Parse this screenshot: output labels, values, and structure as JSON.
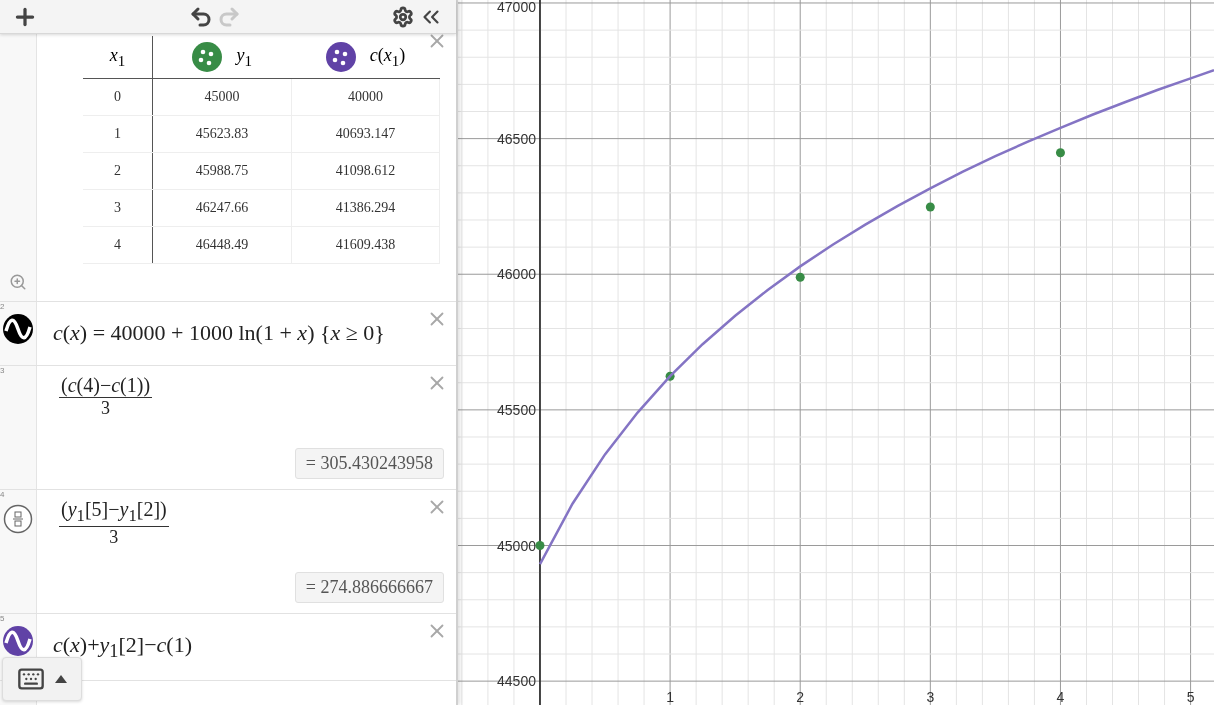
{
  "toolbar": {
    "undo": {
      "disabled": false
    },
    "redo": {
      "disabled": true
    }
  },
  "expressions": [
    {
      "kind": "table",
      "columns": [
        {
          "header": "*x*$_{1}$"
        },
        {
          "header": "*y*$_{1}$",
          "color": "#388c46"
        },
        {
          "header": "*c*(*x*$_{1}$)",
          "color": "#6042a6"
        }
      ],
      "rows": [
        [
          "0",
          "45000",
          "40000"
        ],
        [
          "1",
          "45623.83",
          "40693.147"
        ],
        [
          "2",
          "45988.75",
          "41098.612"
        ],
        [
          "3",
          "46247.66",
          "41386.294"
        ],
        [
          "4",
          "46448.49",
          "41609.438"
        ]
      ]
    },
    {
      "kind": "function",
      "number": "2",
      "color": "#000000",
      "latex": "*c*(*x*) = 40000 + 1000 ln(1 + *x*) {*x* ≥ 0}"
    },
    {
      "kind": "fraction",
      "number": "3",
      "numerator": "(*c*(4)−*c*(1))",
      "denominator": "3",
      "result": "= 305.430243958"
    },
    {
      "kind": "fraction",
      "number": "4",
      "numerator": "(*y*$_{1}$[5]−*y*$_{1}$[2])",
      "denominator": "3",
      "result": "= 274.886666667"
    },
    {
      "kind": "function",
      "number": "5",
      "color": "#6042a6",
      "latex": "*c*(*x*)+*y*$_{1}$[2]−*c*(1)"
    }
  ],
  "graph": {
    "chart_data": {
      "type": "line",
      "grid": true,
      "x": [
        0,
        0.25,
        0.5,
        0.75,
        1,
        1.25,
        1.5,
        1.75,
        2,
        2.25,
        2.5,
        2.75,
        3,
        3.25,
        3.5,
        3.75,
        4,
        4.25,
        4.5,
        4.75,
        5,
        5.18
      ],
      "series": [
        {
          "type": "scatter",
          "color": "#388c46",
          "values": [
            45000,
            null,
            null,
            null,
            45624,
            null,
            null,
            null,
            45989,
            null,
            null,
            null,
            46248,
            null,
            null,
            null,
            46448,
            null,
            null,
            null,
            null,
            null
          ]
        },
        {
          "color": "#8474c4",
          "values": [
            44931,
            45154,
            45336,
            45490,
            45624,
            45742,
            45847,
            45942,
            46029,
            46109,
            46183,
            46252,
            46317,
            46378,
            46435,
            46489,
            46540,
            46589,
            46635,
            46680,
            46722,
            46752
          ]
        }
      ],
      "xlim": [
        -0.63,
        5.18
      ],
      "ylim": [
        44412,
        47011
      ],
      "xticks": [
        {
          "value": 1,
          "label": "1"
        },
        {
          "value": 2,
          "label": "2"
        },
        {
          "value": 3,
          "label": "3"
        },
        {
          "value": 4,
          "label": "4"
        },
        {
          "value": 5,
          "label": "5"
        }
      ],
      "yticks": [
        {
          "value": 44500,
          "label": "44500"
        },
        {
          "value": 45000,
          "label": "45000"
        },
        {
          "value": 45500,
          "label": "45500"
        },
        {
          "value": 46000,
          "label": "46000"
        },
        {
          "value": 46500,
          "label": "46500"
        },
        {
          "value": 47000,
          "label": "47000"
        }
      ]
    }
  }
}
